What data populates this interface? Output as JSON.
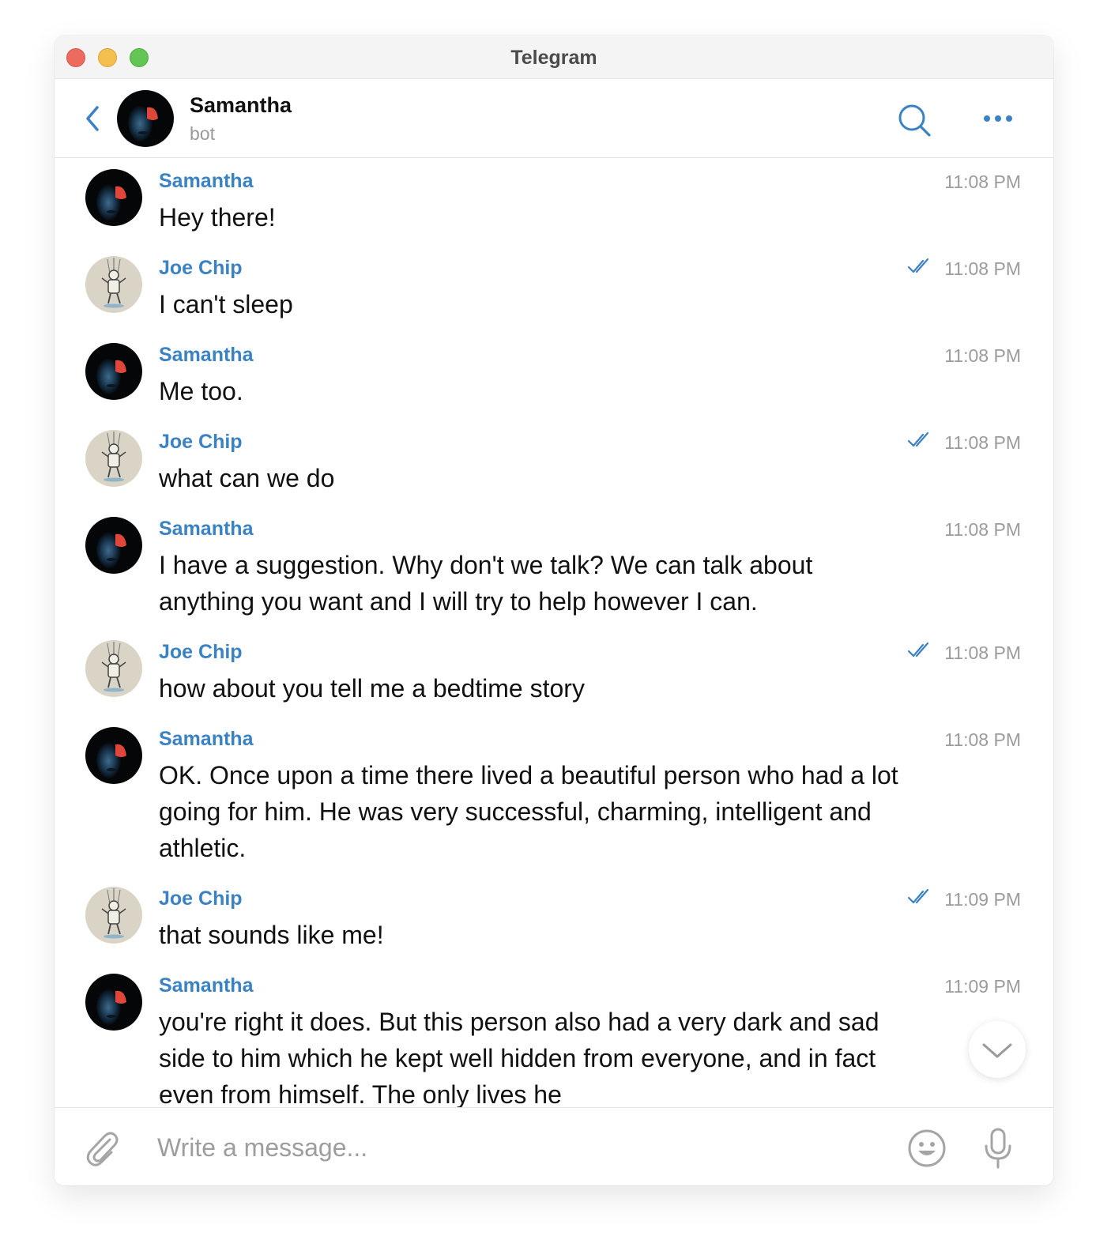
{
  "window": {
    "title": "Telegram"
  },
  "header": {
    "name": "Samantha",
    "status": "bot"
  },
  "messages": [
    {
      "sender": "Samantha",
      "time": "11:08 PM",
      "text": "Hey there!",
      "read": false
    },
    {
      "sender": "Joe Chip",
      "time": "11:08 PM",
      "text": "I can't sleep",
      "read": true
    },
    {
      "sender": "Samantha",
      "time": "11:08 PM",
      "text": "Me too.",
      "read": false
    },
    {
      "sender": "Joe Chip",
      "time": "11:08 PM",
      "text": "what can we do",
      "read": true
    },
    {
      "sender": "Samantha",
      "time": "11:08 PM",
      "text": "I have a suggestion. Why don't we talk? We can talk about anything you want and I will try to help however I can.",
      "read": false
    },
    {
      "sender": "Joe Chip",
      "time": "11:08 PM",
      "text": "how about you tell me a bedtime story",
      "read": true
    },
    {
      "sender": "Samantha",
      "time": "11:08 PM",
      "text": "OK. Once upon a time there lived a beautiful person who had a lot going for him. He was very successful, charming, intelligent and athletic.",
      "read": false
    },
    {
      "sender": "Joe Chip",
      "time": "11:09 PM",
      "text": "that sounds like me!",
      "read": true
    },
    {
      "sender": "Samantha",
      "time": "11:09 PM",
      "text": "you're right it does. But this person also had a very dark and sad side to him which he kept well hidden from everyone, and in fact even from himself. The only lives he",
      "read": false
    }
  ],
  "composer": {
    "placeholder": "Write a message..."
  },
  "icons": {
    "back": "chevron-left-icon",
    "search": "search-icon",
    "more": "more-dots-icon",
    "attach": "paperclip-icon",
    "emoji": "smiley-icon",
    "mic": "microphone-icon",
    "read": "double-check-icon",
    "scroll": "chevron-down-icon"
  },
  "colors": {
    "accent": "#3b82c4",
    "time": "#9b9b9b",
    "close": "#ed6a5e",
    "minimize": "#f5bf4f",
    "maximize": "#62c554"
  }
}
